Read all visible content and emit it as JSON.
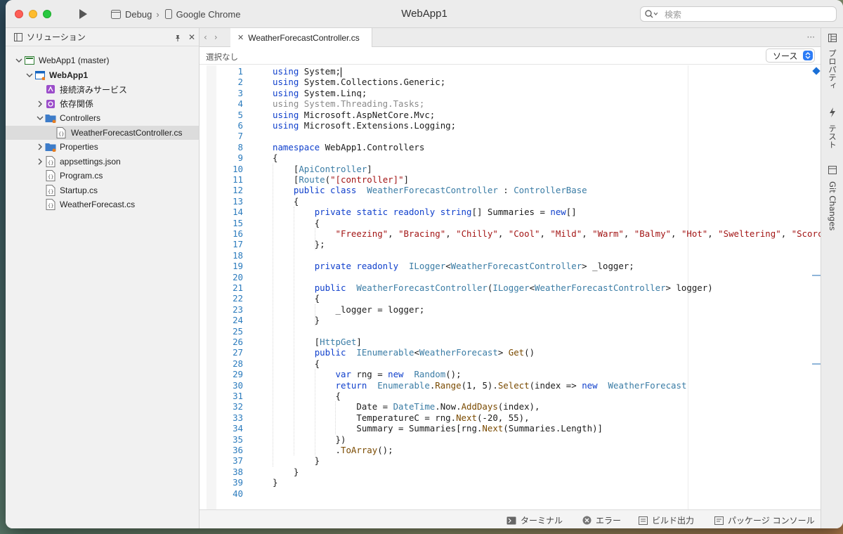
{
  "titlebar": {
    "config": "Debug",
    "device": "Google Chrome",
    "title": "WebApp1",
    "search_placeholder": "検索"
  },
  "solution_pad": {
    "title": "ソリューション",
    "items": [
      {
        "label": "WebApp1 (master)",
        "icon": "solution-icon",
        "chevron": "down",
        "level": 0
      },
      {
        "label": "WebApp1",
        "icon": "project-icon",
        "chevron": "down",
        "level": 1,
        "bold": true
      },
      {
        "label": "接続済みサービス",
        "icon": "connected-services-icon",
        "chevron": "",
        "level": 2
      },
      {
        "label": "依存関係",
        "icon": "dependencies-icon",
        "chevron": "right",
        "level": 2
      },
      {
        "label": "Controllers",
        "icon": "folder-icon",
        "chevron": "down",
        "level": 2
      },
      {
        "label": "WeatherForecastController.cs",
        "icon": "csharp-file-icon",
        "chevron": "",
        "level": 3,
        "selected": true
      },
      {
        "label": "Properties",
        "icon": "folder-icon",
        "chevron": "right",
        "level": 2
      },
      {
        "label": "appsettings.json",
        "icon": "json-file-icon",
        "chevron": "right",
        "level": 2
      },
      {
        "label": "Program.cs",
        "icon": "csharp-file-icon",
        "chevron": "",
        "level": 2
      },
      {
        "label": "Startup.cs",
        "icon": "csharp-file-icon",
        "chevron": "",
        "level": 2
      },
      {
        "label": "WeatherForecast.cs",
        "icon": "csharp-file-icon",
        "chevron": "",
        "level": 2
      }
    ]
  },
  "editor": {
    "tab_label": "WeatherForecastController.cs",
    "path_selection": "選択なし",
    "source_select": "ソース",
    "lines": [
      [
        [
          "kw",
          "using"
        ],
        [
          "",
          "System;"
        ],
        [
          "caret",
          ""
        ]
      ],
      [
        [
          "kw",
          "using"
        ],
        [
          "",
          "System.Collections.Generic;"
        ]
      ],
      [
        [
          "kw",
          "using"
        ],
        [
          "",
          "System.Linq;"
        ]
      ],
      [
        [
          "dim",
          "using System.Threading.Tasks;"
        ]
      ],
      [
        [
          "kw",
          "using"
        ],
        [
          "",
          "Microsoft.AspNetCore.Mvc;"
        ]
      ],
      [
        [
          "kw",
          "using"
        ],
        [
          "",
          "Microsoft.Extensions.Logging;"
        ]
      ],
      [],
      [
        [
          "kw",
          "namespace"
        ],
        [
          "",
          "WebApp1.Controllers"
        ]
      ],
      [
        [
          "",
          "{"
        ]
      ],
      [
        [
          "",
          "    ["
        ],
        [
          "ty",
          "ApiController"
        ],
        [
          "",
          "]"
        ]
      ],
      [
        [
          "",
          "    ["
        ],
        [
          "ty",
          "Route"
        ],
        [
          "",
          "("
        ],
        [
          "st",
          "\"[controller]\""
        ],
        [
          "",
          "]"
        ]
      ],
      [
        [
          "",
          "    "
        ],
        [
          "kw",
          "public class"
        ],
        [
          "",
          ""
        ],
        [
          "ty",
          "WeatherForecastController"
        ],
        [
          "",
          " : "
        ],
        [
          "ty",
          "ControllerBase"
        ]
      ],
      [
        [
          "",
          "    {"
        ]
      ],
      [
        [
          "",
          "        "
        ],
        [
          "kw",
          "private static readonly string"
        ],
        [
          "",
          "[] Summaries = "
        ],
        [
          "kw",
          "new"
        ],
        [
          "",
          "[]"
        ]
      ],
      [
        [
          "",
          "        {"
        ]
      ],
      [
        [
          "",
          "            "
        ],
        [
          "st",
          "\"Freezing\""
        ],
        [
          "",
          ", "
        ],
        [
          "st",
          "\"Bracing\""
        ],
        [
          "",
          ", "
        ],
        [
          "st",
          "\"Chilly\""
        ],
        [
          "",
          ", "
        ],
        [
          "st",
          "\"Cool\""
        ],
        [
          "",
          ", "
        ],
        [
          "st",
          "\"Mild\""
        ],
        [
          "",
          ", "
        ],
        [
          "st",
          "\"Warm\""
        ],
        [
          "",
          ", "
        ],
        [
          "st",
          "\"Balmy\""
        ],
        [
          "",
          ", "
        ],
        [
          "st",
          "\"Hot\""
        ],
        [
          "",
          ", "
        ],
        [
          "st",
          "\"Sweltering\""
        ],
        [
          "",
          ", "
        ],
        [
          "st",
          "\"Scorc"
        ]
      ],
      [
        [
          "",
          "        };"
        ]
      ],
      [],
      [
        [
          "",
          "        "
        ],
        [
          "kw",
          "private readonly"
        ],
        [
          "",
          ""
        ],
        [
          "ty",
          "ILogger"
        ],
        [
          "",
          "<"
        ],
        [
          "ty",
          "WeatherForecastController"
        ],
        [
          "",
          "> _logger;"
        ]
      ],
      [],
      [
        [
          "",
          "        "
        ],
        [
          "kw",
          "public"
        ],
        [
          "",
          ""
        ],
        [
          "ty",
          "WeatherForecastController"
        ],
        [
          "",
          "("
        ],
        [
          "ty",
          "ILogger"
        ],
        [
          "",
          "<"
        ],
        [
          "ty",
          "WeatherForecastController"
        ],
        [
          "",
          "> logger)"
        ]
      ],
      [
        [
          "",
          "        {"
        ]
      ],
      [
        [
          "",
          "            _logger = logger;"
        ]
      ],
      [
        [
          "",
          "        }"
        ]
      ],
      [],
      [
        [
          "",
          "        ["
        ],
        [
          "ty",
          "HttpGet"
        ],
        [
          "",
          "]"
        ]
      ],
      [
        [
          "",
          "        "
        ],
        [
          "kw",
          "public"
        ],
        [
          "",
          ""
        ],
        [
          "ty",
          "IEnumerable"
        ],
        [
          "",
          "<"
        ],
        [
          "ty",
          "WeatherForecast"
        ],
        [
          "",
          "> "
        ],
        [
          "mt",
          "Get"
        ],
        [
          "",
          "()"
        ]
      ],
      [
        [
          "",
          "        {"
        ]
      ],
      [
        [
          "",
          "            "
        ],
        [
          "kw",
          "var"
        ],
        [
          "",
          " rng = "
        ],
        [
          "kw",
          "new"
        ],
        [
          "",
          ""
        ],
        [
          "ty",
          "Random"
        ],
        [
          "",
          "();"
        ]
      ],
      [
        [
          "",
          "            "
        ],
        [
          "kw",
          "return"
        ],
        [
          "",
          ""
        ],
        [
          "ty",
          "Enumerable"
        ],
        [
          "",
          "."
        ],
        [
          "mt",
          "Range"
        ],
        [
          "",
          "(1, 5)."
        ],
        [
          "mt",
          "Select"
        ],
        [
          "",
          "(index => "
        ],
        [
          "kw",
          "new"
        ],
        [
          "",
          ""
        ],
        [
          "ty",
          "WeatherForecast"
        ]
      ],
      [
        [
          "",
          "            {"
        ]
      ],
      [
        [
          "",
          "                Date = "
        ],
        [
          "ty",
          "DateTime"
        ],
        [
          "",
          ".Now."
        ],
        [
          "mt",
          "AddDays"
        ],
        [
          "",
          "(index),"
        ]
      ],
      [
        [
          "",
          "                TemperatureC = rng."
        ],
        [
          "mt",
          "Next"
        ],
        [
          "",
          "(-20, 55),"
        ]
      ],
      [
        [
          "",
          "                Summary = Summaries[rng."
        ],
        [
          "mt",
          "Next"
        ],
        [
          "",
          "(Summaries.Length)]"
        ]
      ],
      [
        [
          "",
          "            })"
        ]
      ],
      [
        [
          "",
          "            ."
        ],
        [
          "mt",
          "ToArray"
        ],
        [
          "",
          "();"
        ]
      ],
      [
        [
          "",
          "        }"
        ]
      ],
      [
        [
          "",
          "    }"
        ]
      ],
      [
        [
          "",
          "}"
        ]
      ],
      []
    ]
  },
  "right_dock": {
    "items": [
      {
        "label": "プロパティ",
        "icon": "properties-icon"
      },
      {
        "label": "テスト",
        "icon": "test-icon"
      },
      {
        "label": "Git Changes",
        "icon": "git-changes-icon"
      }
    ]
  },
  "statusbar": {
    "items": [
      {
        "label": "ターミナル",
        "icon": "terminal-icon"
      },
      {
        "label": "エラー",
        "icon": "error-icon"
      },
      {
        "label": "ビルド出力",
        "icon": "build-output-icon"
      },
      {
        "label": "パッケージ コンソール",
        "icon": "package-console-icon"
      }
    ]
  },
  "colors": {
    "keyword": "#1040cc",
    "type": "#3a7ca5",
    "string": "#a31515",
    "line_number": "#2b7bbd",
    "accent": "#2d7cf6"
  }
}
